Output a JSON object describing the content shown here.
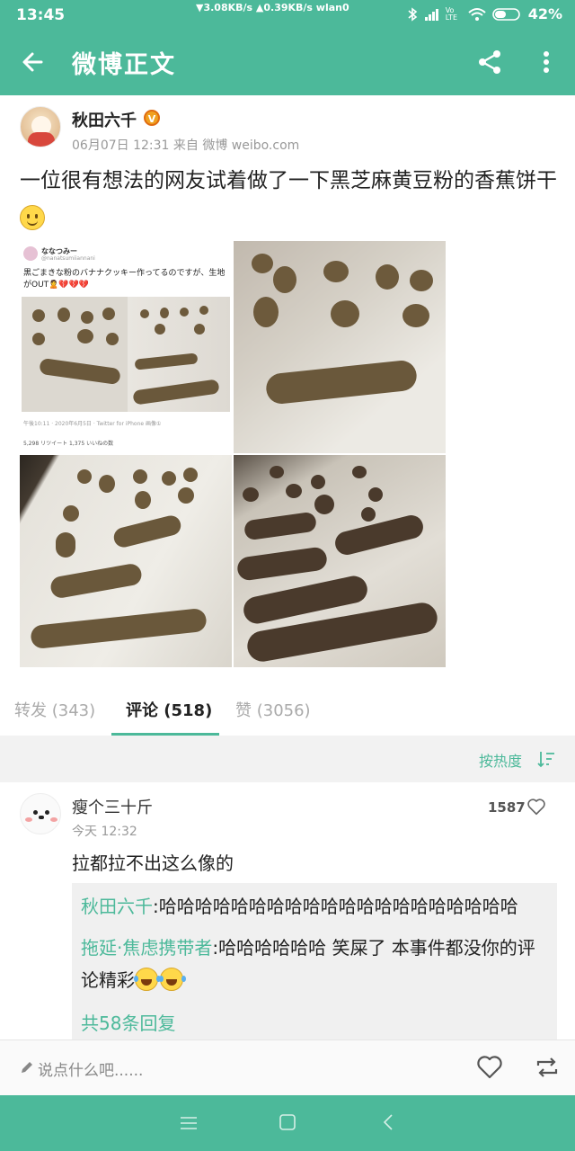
{
  "status_bar": {
    "time": "13:45",
    "network": "▼3.08KB/s ▲0.39KB/s  wlan0",
    "signal_label": "Vo LTE",
    "battery": "42%"
  },
  "app_bar": {
    "title": "微博正文",
    "icons": [
      "back-arrow-icon",
      "share-icon",
      "more-vertical-icon"
    ]
  },
  "post": {
    "author": "秋田六千",
    "verified_badge": "V",
    "meta": "06月07日 12:31  来自 微博 weibo.com",
    "text": "一位很有想法的网友试着做了一下黑芝麻黄豆粉的香蕉饼干",
    "photos": {
      "tweet_name": "ななつみー",
      "tweet_handle": "@nanatsumiiannani",
      "tweet_text": "黒ごまきな粉のバナナクッキー作ってるのですが、生地がOUT🙎💔💔💔",
      "tweet_time": "午後10:11 · 2020年6月5日 · Twitter for iPhone  画像①",
      "tweet_stats": "5,298 リツイート    1,375 いいねの数"
    }
  },
  "tabs": [
    {
      "label": "转发 (343)",
      "active": false
    },
    {
      "label": "评论 (518)",
      "active": true
    },
    {
      "label": "赞 (3056)",
      "active": false
    }
  ],
  "sort": {
    "label": "按热度"
  },
  "comment": {
    "name": "瘦个三十斤",
    "time": "今天 12:32",
    "likes": "1587",
    "text": "拉都拉不出这么像的",
    "replies": [
      {
        "who": "秋田六千",
        "text": ":哈哈哈哈哈哈哈哈哈哈哈哈哈哈哈哈哈哈哈哈"
      },
      {
        "who": "拖延·焦虑携带者",
        "text": ":哈哈哈哈哈哈 笑屎了 本事件都没你的评论精彩"
      }
    ],
    "more_replies": "共58条回复"
  },
  "input_bar": {
    "placeholder": "说点什么吧......"
  },
  "colors": {
    "brand": "#4cb99a",
    "link": "#4cb99a"
  }
}
